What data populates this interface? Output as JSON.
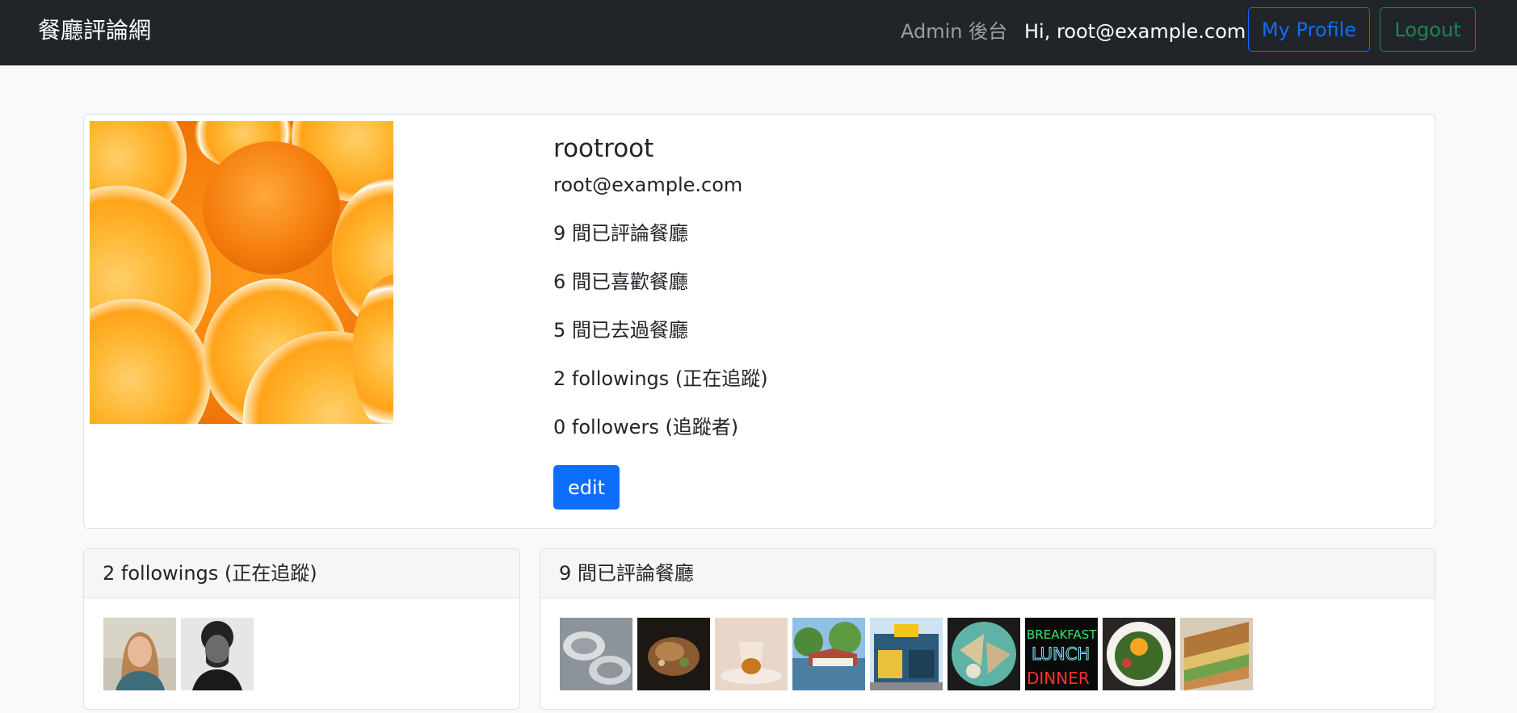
{
  "navbar": {
    "brand": "餐廳評論網",
    "admin_link": "Admin 後台",
    "greeting": "Hi, root@example.com",
    "my_profile_label": "My Profile",
    "logout_label": "Logout"
  },
  "profile": {
    "name": "rootroot",
    "email": "root@example.com",
    "reviewed_count": "9 間已評論餐廳",
    "favorited_count": "6 間已喜歡餐廳",
    "visited_count": "5 間已去過餐廳",
    "followings_count": "2 followings (正在追蹤)",
    "followers_count": "0 followers (追蹤者)",
    "edit_label": "edit"
  },
  "followings_panel": {
    "title": "2 followings (正在追蹤)",
    "users": [
      {
        "avatar": "woman-portrait"
      },
      {
        "avatar": "man-portrait"
      }
    ]
  },
  "reviewed_panel": {
    "title": "9 間已評論餐廳",
    "restaurants": [
      {
        "image": "oysters"
      },
      {
        "image": "grilled-dish"
      },
      {
        "image": "drink-glass"
      },
      {
        "image": "lakeside-restaurant"
      },
      {
        "image": "storefront"
      },
      {
        "image": "quesadilla-plate"
      },
      {
        "image": "neon-sign",
        "sign_text": [
          "BREAKFAST",
          "LUNCH",
          "DINNER"
        ]
      },
      {
        "image": "salad-bowl"
      },
      {
        "image": "sandwich"
      }
    ]
  }
}
